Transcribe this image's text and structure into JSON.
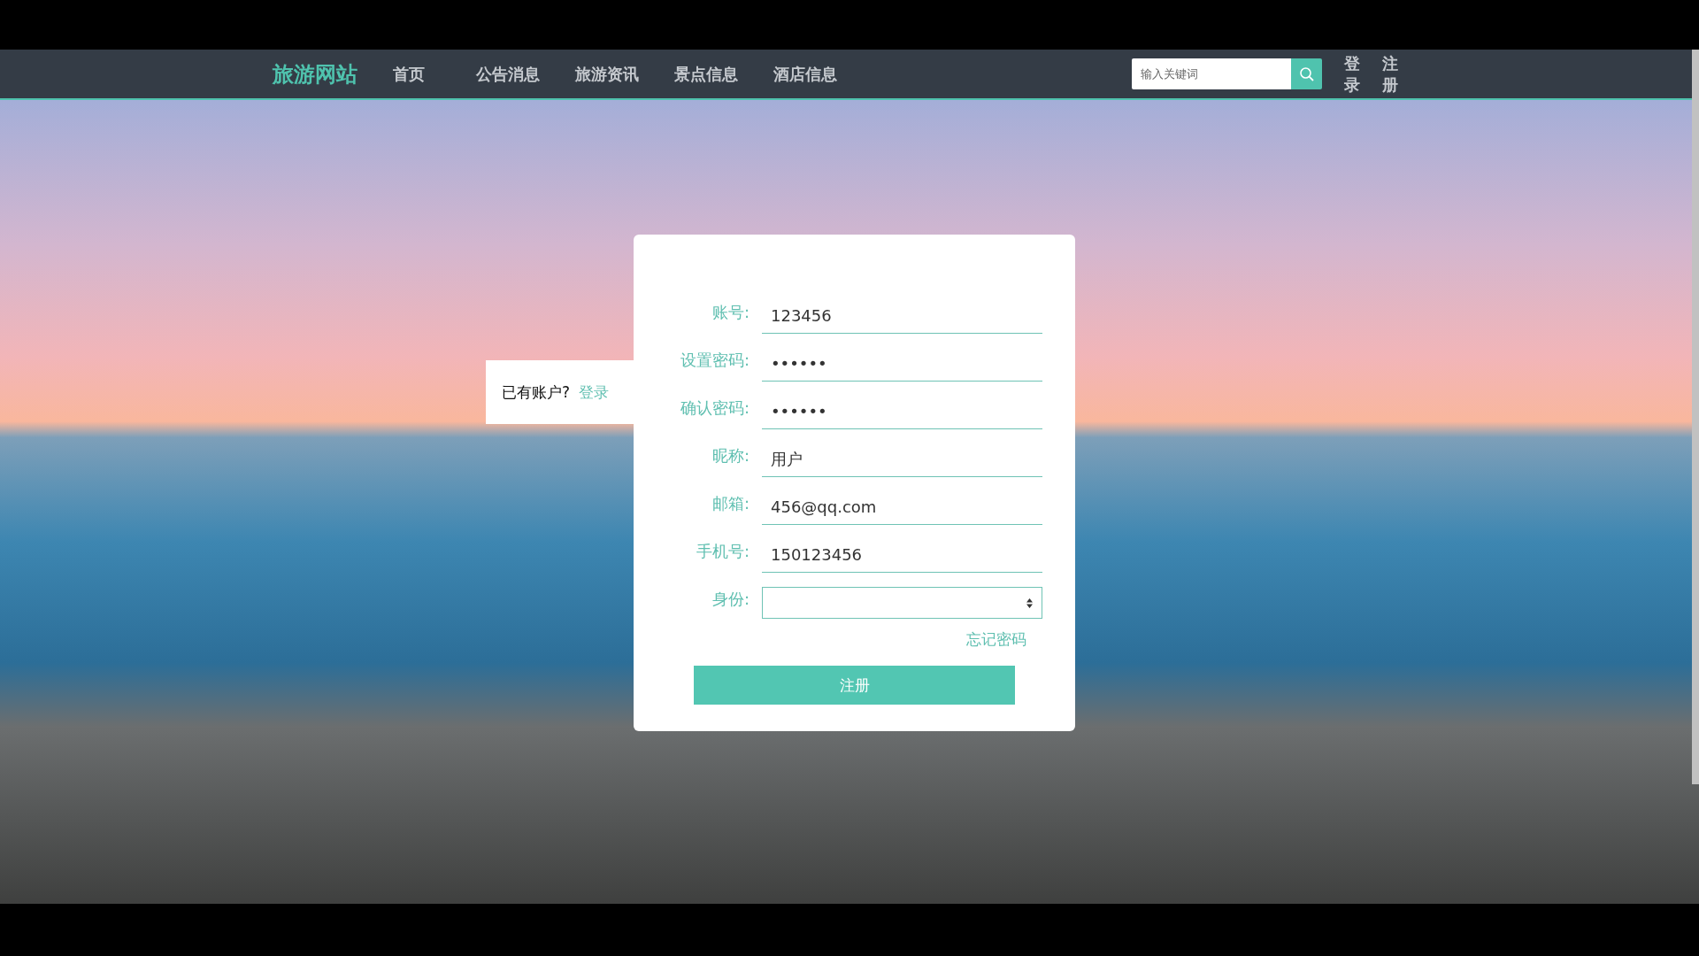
{
  "nav": {
    "logo": "旅游网站",
    "items": [
      {
        "label": "首页"
      },
      {
        "label": "公告消息"
      },
      {
        "label": "旅游资讯"
      },
      {
        "label": "景点信息"
      },
      {
        "label": "酒店信息"
      }
    ],
    "search": {
      "placeholder": "输入关键词"
    },
    "login": "登录",
    "register": "注册"
  },
  "side_tab": {
    "text": "已有账户?",
    "link": "登录"
  },
  "form": {
    "fields": [
      {
        "kind": "text",
        "label": "账号:",
        "value": "123456"
      },
      {
        "kind": "text",
        "label": "设置密码:",
        "value": "••••••"
      },
      {
        "kind": "text",
        "label": "确认密码:",
        "value": "••••••"
      },
      {
        "kind": "text",
        "label": "昵称:",
        "value": "用户"
      },
      {
        "kind": "text",
        "label": "邮箱:",
        "value": "456@qq.com"
      },
      {
        "kind": "text",
        "label": "手机号:",
        "value": "150123456"
      },
      {
        "kind": "select",
        "label": "身份:"
      }
    ],
    "forgot": "忘记密码",
    "submit": "注册"
  }
}
